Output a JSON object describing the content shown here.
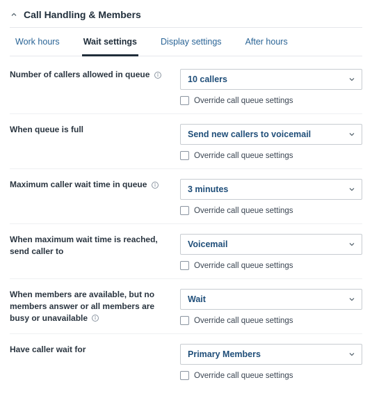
{
  "header": {
    "title": "Call Handling & Members"
  },
  "tabs": [
    {
      "label": "Work hours",
      "active": false
    },
    {
      "label": "Wait settings",
      "active": true
    },
    {
      "label": "Display settings",
      "active": false
    },
    {
      "label": "After hours",
      "active": false
    }
  ],
  "override_label": "Override call queue settings",
  "rows": [
    {
      "label": "Number of callers allowed in queue",
      "info": true,
      "value": "10 callers",
      "override_checked": false
    },
    {
      "label": "When queue is full",
      "info": false,
      "value": "Send new callers to voicemail",
      "override_checked": false
    },
    {
      "label": "Maximum caller wait time in queue",
      "info": true,
      "value": "3 minutes",
      "override_checked": false
    },
    {
      "label": "When maximum wait time is reached, send caller to",
      "info": false,
      "value": "Voicemail",
      "override_checked": false
    },
    {
      "label": "When members are available, but no members answer or all members are busy or unavailable",
      "info": true,
      "value": "Wait",
      "override_checked": false
    },
    {
      "label": "Have caller wait for",
      "info": false,
      "value": "Primary Members",
      "override_checked": false
    }
  ]
}
